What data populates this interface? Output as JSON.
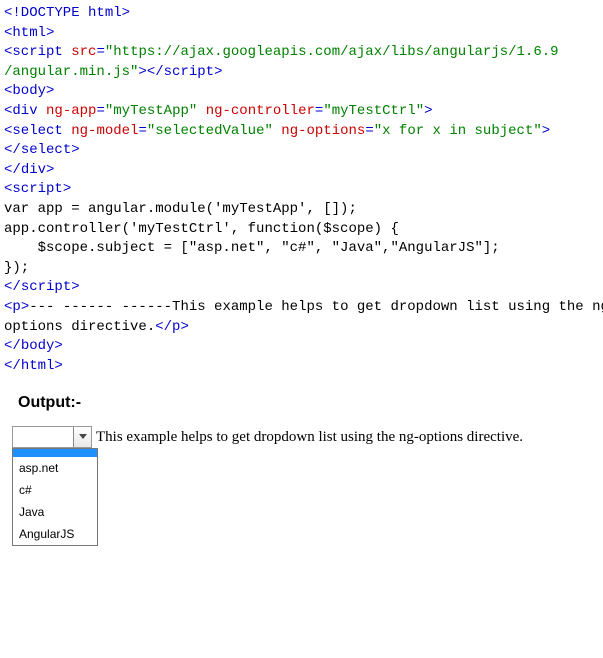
{
  "code": {
    "l1": "<!DOCTYPE html>",
    "l2_open": "<",
    "l2_tag": "html",
    "l2_close": ">",
    "l3_open": "<",
    "l3_tag": "script",
    "l3_sp": " ",
    "l3_attr": "src",
    "l3_eq": "=",
    "l3_val": "\"https://ajax.googleapis.com/ajax/libs/angularjs/1.6.9",
    "l4_val": "/angular.min.js\"",
    "l4_close1": "></",
    "l4_tag": "script",
    "l4_close2": ">",
    "l5_open": "<",
    "l5_tag": "body",
    "l5_close": ">",
    "blank1": "",
    "l6_open": "<",
    "l6_tag": "div",
    "l6_sp": " ",
    "l6_a1": "ng-app",
    "l6_eq1": "=",
    "l6_v1": "\"myTestApp\"",
    "l6_sp2": " ",
    "l6_a2": "ng-controller",
    "l6_eq2": "=",
    "l6_v2": "\"myTestCtrl\"",
    "l6_close": ">",
    "blank2": "",
    "l7_open": "<",
    "l7_tag": "select",
    "l7_sp": " ",
    "l7_a1": "ng-model",
    "l7_eq1": "=",
    "l7_v1": "\"selectedValue\"",
    "l7_sp2": " ",
    "l7_a2": "ng-options",
    "l7_eq2": "=",
    "l7_v2": "\"x for x in subject\"",
    "l7_close": ">",
    "l8_open": "</",
    "l8_tag": "select",
    "l8_close": ">",
    "blank3": "",
    "l9_open": "</",
    "l9_tag": "div",
    "l9_close": ">",
    "blank4": "",
    "l10_open": "<",
    "l10_tag": "script",
    "l10_close": ">",
    "l11": "var app = angular.module('myTestApp', []);",
    "l12": "app.controller('myTestCtrl', function($scope) {",
    "l13": "    $scope.subject = [\"asp.net\", \"c#\", \"Java\",\"AngularJS\"];",
    "l14": "});",
    "l15_open": "</",
    "l15_tag": "script",
    "l15_close": ">",
    "blank5": "",
    "l16_open": "<",
    "l16_tag": "p",
    "l16_close": ">",
    "l16_txt": "--- ------ ------This example helps to get dropdown list using the ng-",
    "l17_txt": "options directive.",
    "l17_open": "</",
    "l17_tag": "p",
    "l17_close": ">",
    "blank6": "",
    "l18_open": "</",
    "l18_tag": "body",
    "l18_close": ">",
    "l19_open": "</",
    "l19_tag": "html",
    "l19_close": ">"
  },
  "output": {
    "label": "Output:-",
    "after_text": "This example helps to get dropdown list using the ng-options directive.",
    "options": {
      "o0": "",
      "o1": "asp.net",
      "o2": "c#",
      "o3": "Java",
      "o4": "AngularJS"
    }
  }
}
